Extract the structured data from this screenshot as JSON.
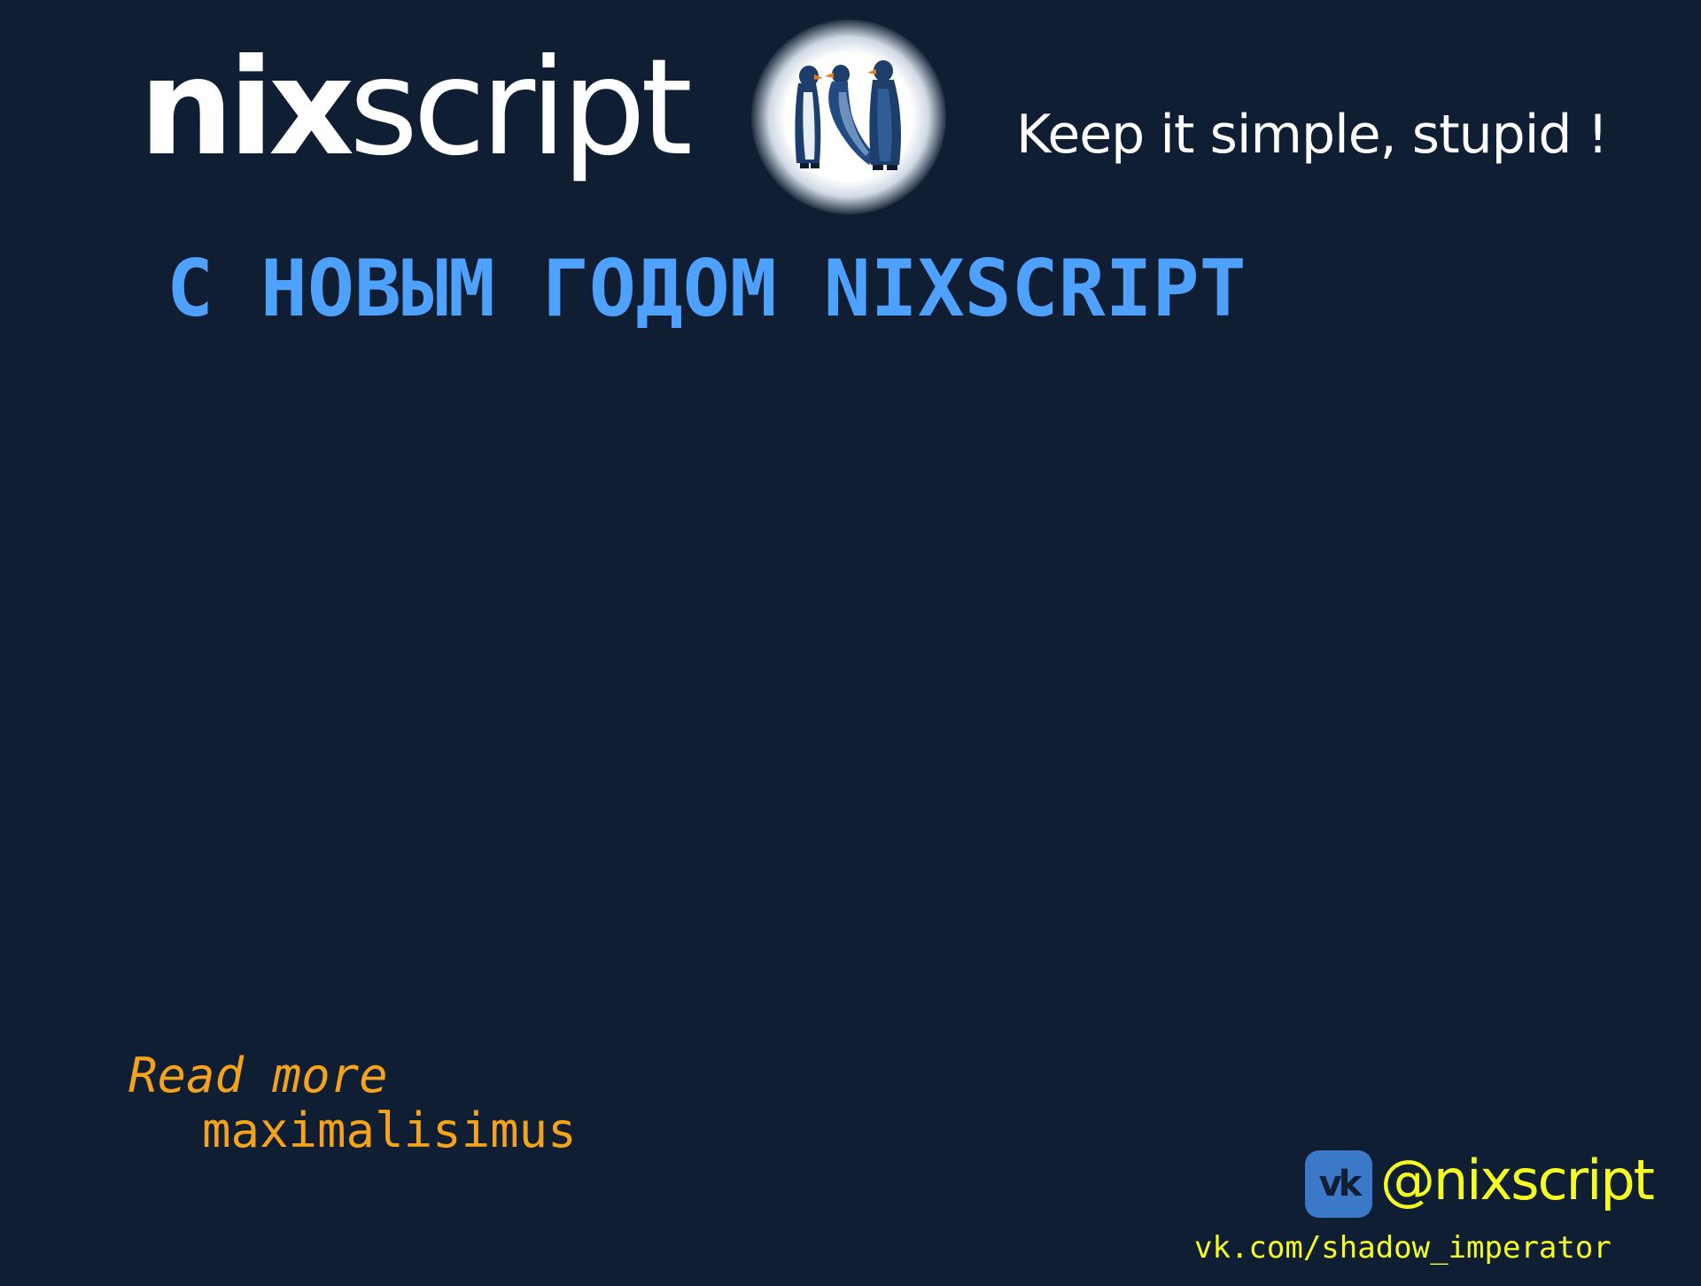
{
  "logo": {
    "part_bold": "nix",
    "part_regular": "script"
  },
  "badge": {
    "icon": "penguins-n-logo-icon"
  },
  "tagline": "Keep it simple, stupid !",
  "headline": "С НОВЫМ ГОДОМ NIXSCRIPT",
  "read_more": {
    "label": "Read more",
    "author": "maximalisimus"
  },
  "social": {
    "icon": "vk-icon",
    "icon_text": "vk",
    "handle": "@nixscript",
    "url": "vk.com/shadow_imperator"
  },
  "colors": {
    "background": "#0f1e32",
    "headline": "#4ea1ff",
    "read_more": "#f5a31a",
    "social": "#f7ff1f",
    "vk_brand": "#3b79c8"
  }
}
